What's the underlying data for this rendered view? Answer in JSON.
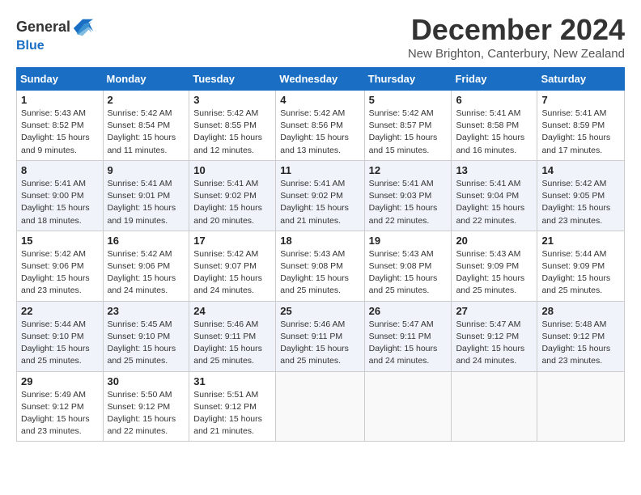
{
  "header": {
    "logo_line1": "General",
    "logo_line2": "Blue",
    "month_title": "December 2024",
    "location": "New Brighton, Canterbury, New Zealand"
  },
  "weekdays": [
    "Sunday",
    "Monday",
    "Tuesday",
    "Wednesday",
    "Thursday",
    "Friday",
    "Saturday"
  ],
  "weeks": [
    [
      {
        "day": "1",
        "sunrise": "5:43 AM",
        "sunset": "8:52 PM",
        "daylight": "15 hours and 9 minutes."
      },
      {
        "day": "2",
        "sunrise": "5:42 AM",
        "sunset": "8:54 PM",
        "daylight": "15 hours and 11 minutes."
      },
      {
        "day": "3",
        "sunrise": "5:42 AM",
        "sunset": "8:55 PM",
        "daylight": "15 hours and 12 minutes."
      },
      {
        "day": "4",
        "sunrise": "5:42 AM",
        "sunset": "8:56 PM",
        "daylight": "15 hours and 13 minutes."
      },
      {
        "day": "5",
        "sunrise": "5:42 AM",
        "sunset": "8:57 PM",
        "daylight": "15 hours and 15 minutes."
      },
      {
        "day": "6",
        "sunrise": "5:41 AM",
        "sunset": "8:58 PM",
        "daylight": "15 hours and 16 minutes."
      },
      {
        "day": "7",
        "sunrise": "5:41 AM",
        "sunset": "8:59 PM",
        "daylight": "15 hours and 17 minutes."
      }
    ],
    [
      {
        "day": "8",
        "sunrise": "5:41 AM",
        "sunset": "9:00 PM",
        "daylight": "15 hours and 18 minutes."
      },
      {
        "day": "9",
        "sunrise": "5:41 AM",
        "sunset": "9:01 PM",
        "daylight": "15 hours and 19 minutes."
      },
      {
        "day": "10",
        "sunrise": "5:41 AM",
        "sunset": "9:02 PM",
        "daylight": "15 hours and 20 minutes."
      },
      {
        "day": "11",
        "sunrise": "5:41 AM",
        "sunset": "9:02 PM",
        "daylight": "15 hours and 21 minutes."
      },
      {
        "day": "12",
        "sunrise": "5:41 AM",
        "sunset": "9:03 PM",
        "daylight": "15 hours and 22 minutes."
      },
      {
        "day": "13",
        "sunrise": "5:41 AM",
        "sunset": "9:04 PM",
        "daylight": "15 hours and 22 minutes."
      },
      {
        "day": "14",
        "sunrise": "5:42 AM",
        "sunset": "9:05 PM",
        "daylight": "15 hours and 23 minutes."
      }
    ],
    [
      {
        "day": "15",
        "sunrise": "5:42 AM",
        "sunset": "9:06 PM",
        "daylight": "15 hours and 23 minutes."
      },
      {
        "day": "16",
        "sunrise": "5:42 AM",
        "sunset": "9:06 PM",
        "daylight": "15 hours and 24 minutes."
      },
      {
        "day": "17",
        "sunrise": "5:42 AM",
        "sunset": "9:07 PM",
        "daylight": "15 hours and 24 minutes."
      },
      {
        "day": "18",
        "sunrise": "5:43 AM",
        "sunset": "9:08 PM",
        "daylight": "15 hours and 25 minutes."
      },
      {
        "day": "19",
        "sunrise": "5:43 AM",
        "sunset": "9:08 PM",
        "daylight": "15 hours and 25 minutes."
      },
      {
        "day": "20",
        "sunrise": "5:43 AM",
        "sunset": "9:09 PM",
        "daylight": "15 hours and 25 minutes."
      },
      {
        "day": "21",
        "sunrise": "5:44 AM",
        "sunset": "9:09 PM",
        "daylight": "15 hours and 25 minutes."
      }
    ],
    [
      {
        "day": "22",
        "sunrise": "5:44 AM",
        "sunset": "9:10 PM",
        "daylight": "15 hours and 25 minutes."
      },
      {
        "day": "23",
        "sunrise": "5:45 AM",
        "sunset": "9:10 PM",
        "daylight": "15 hours and 25 minutes."
      },
      {
        "day": "24",
        "sunrise": "5:46 AM",
        "sunset": "9:11 PM",
        "daylight": "15 hours and 25 minutes."
      },
      {
        "day": "25",
        "sunrise": "5:46 AM",
        "sunset": "9:11 PM",
        "daylight": "15 hours and 25 minutes."
      },
      {
        "day": "26",
        "sunrise": "5:47 AM",
        "sunset": "9:11 PM",
        "daylight": "15 hours and 24 minutes."
      },
      {
        "day": "27",
        "sunrise": "5:47 AM",
        "sunset": "9:12 PM",
        "daylight": "15 hours and 24 minutes."
      },
      {
        "day": "28",
        "sunrise": "5:48 AM",
        "sunset": "9:12 PM",
        "daylight": "15 hours and 23 minutes."
      }
    ],
    [
      {
        "day": "29",
        "sunrise": "5:49 AM",
        "sunset": "9:12 PM",
        "daylight": "15 hours and 23 minutes."
      },
      {
        "day": "30",
        "sunrise": "5:50 AM",
        "sunset": "9:12 PM",
        "daylight": "15 hours and 22 minutes."
      },
      {
        "day": "31",
        "sunrise": "5:51 AM",
        "sunset": "9:12 PM",
        "daylight": "15 hours and 21 minutes."
      },
      null,
      null,
      null,
      null
    ]
  ],
  "labels": {
    "sunrise": "Sunrise:",
    "sunset": "Sunset:",
    "daylight": "Daylight:"
  }
}
